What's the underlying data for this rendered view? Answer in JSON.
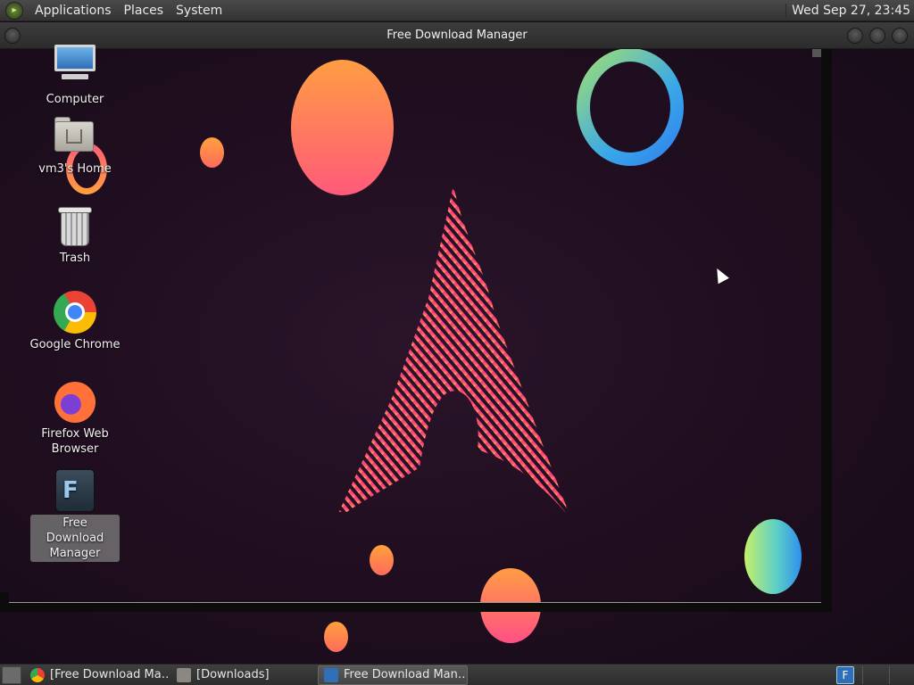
{
  "top_panel": {
    "menus": [
      "Applications",
      "Places",
      "System"
    ],
    "clock": "Wed Sep 27, 23:45"
  },
  "window": {
    "title": "Free Download Manager"
  },
  "desktop_icons": [
    {
      "label": "Computer",
      "icon": "computer-icon"
    },
    {
      "label": "vm3's Home",
      "icon": "home-folder-icon"
    },
    {
      "label": "Trash",
      "icon": "trash-icon"
    },
    {
      "label": "Google Chrome",
      "icon": "chrome-icon"
    },
    {
      "label": "Firefox Web Browser",
      "icon": "firefox-icon"
    },
    {
      "label": "Free Download Manager",
      "icon": "fdm-icon",
      "selected": true
    }
  ],
  "taskbar": {
    "tasks": [
      {
        "label": "[Free Download Ma…",
        "icon": "chrome-icon",
        "active": false
      },
      {
        "label": "[Downloads]",
        "icon": "folder-icon",
        "active": false
      },
      {
        "label": "Free Download Man…",
        "icon": "fdm-icon",
        "active": true
      }
    ],
    "tray_icons": [
      "fdm-tray-icon"
    ]
  },
  "colors": {
    "panel": "#3a3a3a",
    "wallpaper": "#1f0e1f",
    "accent_orange": "#ff9d42",
    "accent_pink": "#ff4f86"
  }
}
